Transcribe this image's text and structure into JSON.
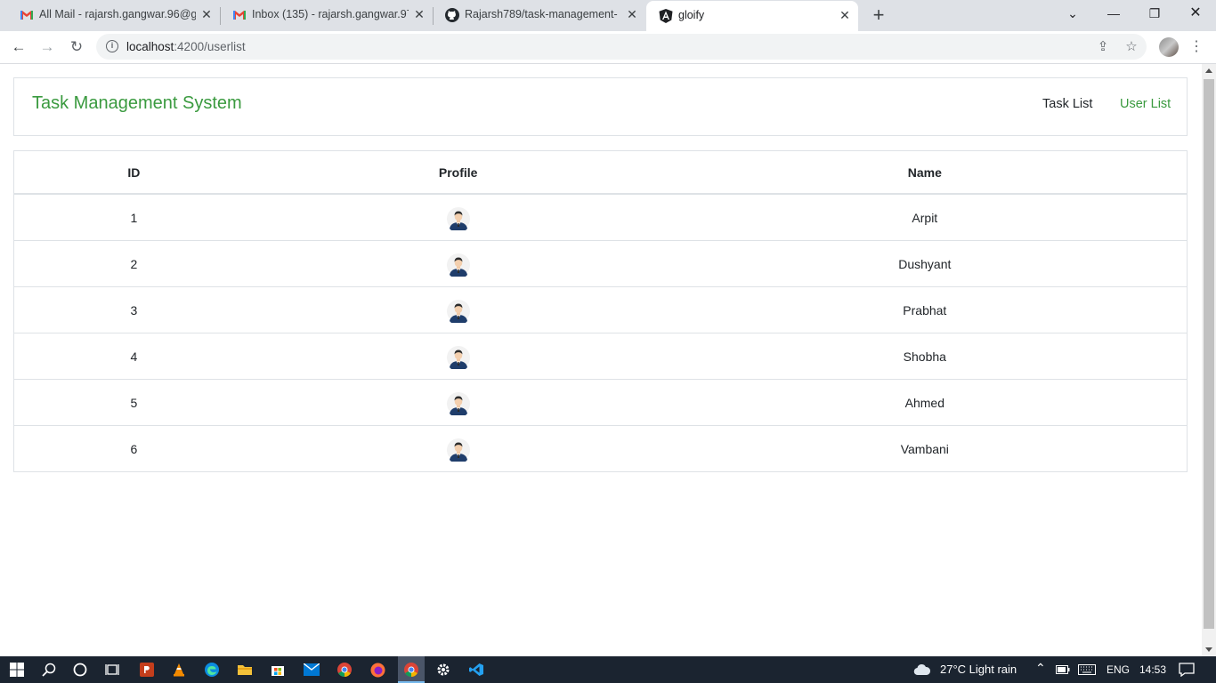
{
  "browser": {
    "tabs": [
      {
        "title": "All Mail - rajarsh.gangwar.96@gm",
        "icon": "gmail-icon",
        "active": false
      },
      {
        "title": "Inbox (135) - rajarsh.gangwar.97@",
        "icon": "gmail-icon",
        "active": false
      },
      {
        "title": "Rajarsh789/task-management-sy",
        "icon": "github-icon",
        "active": false
      },
      {
        "title": "gloify",
        "icon": "angular-icon",
        "active": true
      }
    ],
    "address_bar": {
      "host": "localhost",
      "path": ":4200/userlist"
    }
  },
  "app": {
    "brand": "Task Management System",
    "nav": {
      "task_list": "Task List",
      "user_list": "User List"
    },
    "accent_color": "#3a9a3f"
  },
  "table": {
    "headers": {
      "id": "ID",
      "profile": "Profile",
      "name": "Name"
    },
    "rows": [
      {
        "id": "1",
        "name": "Arpit"
      },
      {
        "id": "2",
        "name": "Dushyant"
      },
      {
        "id": "3",
        "name": "Prabhat"
      },
      {
        "id": "4",
        "name": "Shobha"
      },
      {
        "id": "5",
        "name": "Ahmed"
      },
      {
        "id": "6",
        "name": "Vambani"
      }
    ]
  },
  "taskbar": {
    "weather": "27°C  Light rain",
    "language": "ENG",
    "time": "14:53"
  }
}
